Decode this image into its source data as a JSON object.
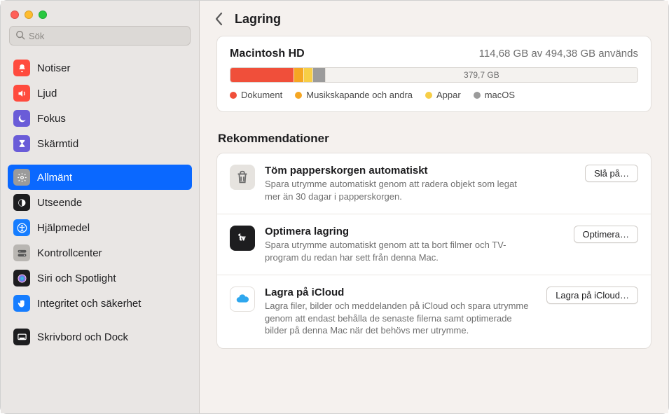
{
  "search": {
    "placeholder": "Sök"
  },
  "sidebar": {
    "items": [
      {
        "label": "Notiser",
        "icon": "bell",
        "bg": "#ff4b3e",
        "fg": "#fff"
      },
      {
        "label": "Ljud",
        "icon": "speaker",
        "bg": "#ff4b3e",
        "fg": "#fff"
      },
      {
        "label": "Fokus",
        "icon": "moon",
        "bg": "#6a5cd8",
        "fg": "#fff"
      },
      {
        "label": "Skärmtid",
        "icon": "hourglass",
        "bg": "#6a5cd8",
        "fg": "#fff"
      },
      {
        "label": "Allmänt",
        "icon": "gear",
        "bg": "#9b9b9b",
        "fg": "#fff",
        "selected": true
      },
      {
        "label": "Utseende",
        "icon": "appearance",
        "bg": "#1d1d1f",
        "fg": "#fff"
      },
      {
        "label": "Hjälpmedel",
        "icon": "accessibility",
        "bg": "#167dff",
        "fg": "#fff"
      },
      {
        "label": "Kontrollcenter",
        "icon": "switches",
        "bg": "#b9b6b2",
        "fg": "#555"
      },
      {
        "label": "Siri och Spotlight",
        "icon": "siri",
        "bg": "#1d1d1f",
        "fg": "#fff"
      },
      {
        "label": "Integritet och säkerhet",
        "icon": "hand",
        "bg": "#167dff",
        "fg": "#fff"
      },
      {
        "label": "Skrivbord och Dock",
        "icon": "dock",
        "bg": "#1d1d1f",
        "fg": "#fff"
      }
    ],
    "spacers_after": [
      3,
      9
    ]
  },
  "header": {
    "title": "Lagring"
  },
  "storage": {
    "disk_name": "Macintosh HD",
    "usage_text": "114,68 GB av 494,38 GB används",
    "free_label": "379,7 GB",
    "segments": [
      {
        "label": "Dokument",
        "color": "#f04f3a",
        "percent": 15.5
      },
      {
        "label": "Musikskapande och andra",
        "color": "#f5a623",
        "percent": 2.4
      },
      {
        "label": "Appar",
        "color": "#f7ce46",
        "percent": 2.2
      },
      {
        "label": "macOS",
        "color": "#9b9b9b",
        "percent": 3.1
      }
    ]
  },
  "recommendations": {
    "title": "Rekommendationer",
    "items": [
      {
        "icon": "trash",
        "icon_bg": "#e6e3df",
        "icon_fg": "#6e6e6e",
        "title": "Töm papperskorgen automatiskt",
        "desc": "Spara utrymme automatiskt genom att radera objekt som legat mer än 30 dagar i papperskorgen.",
        "button": "Slå på…"
      },
      {
        "icon": "appletv",
        "icon_bg": "#1d1d1f",
        "icon_fg": "#ffffff",
        "title": "Optimera lagring",
        "desc": "Spara utrymme automatiskt genom att ta bort filmer och TV-program du redan har sett från denna Mac.",
        "button": "Optimera…"
      },
      {
        "icon": "icloud",
        "icon_bg": "#ffffff",
        "icon_fg": "#2fa7ee",
        "title": "Lagra på iCloud",
        "desc": "Lagra filer, bilder och meddelanden på iCloud och spara utrymme genom att endast behålla de senaste filerna samt optimerade bilder på denna Mac när det behövs mer utrymme.",
        "button": "Lagra på iCloud…"
      }
    ]
  }
}
